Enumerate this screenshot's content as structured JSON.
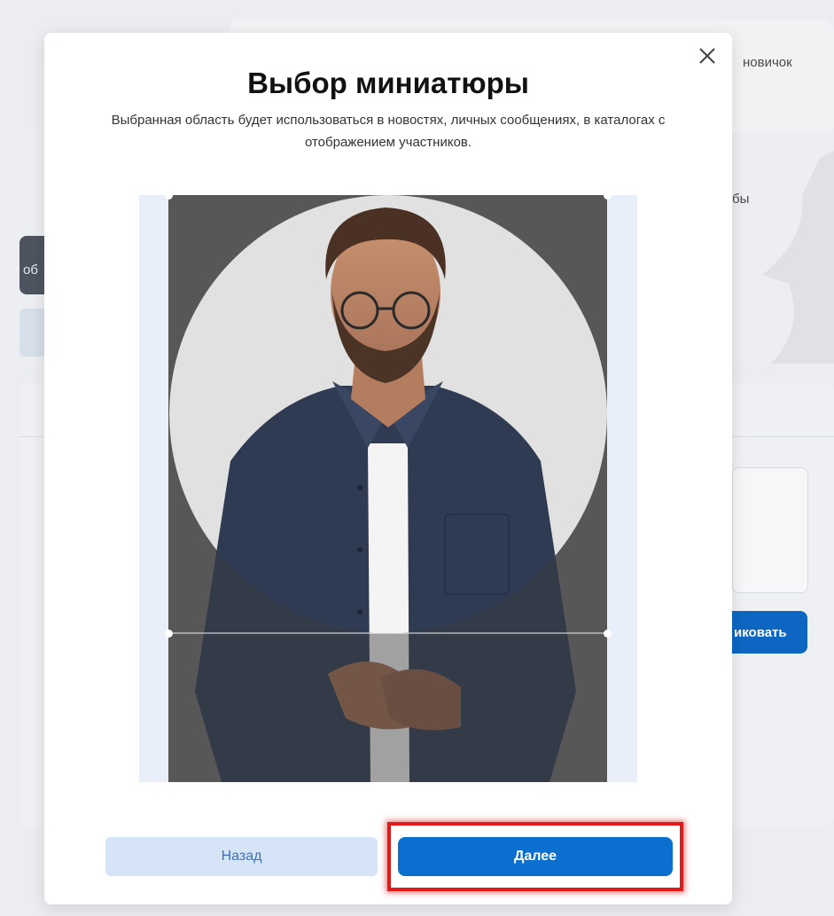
{
  "background": {
    "top_right_label": "новичок",
    "side_partial_text": "бы",
    "left_dark_button_fragment": "об",
    "publish_button_fragment": "иковать"
  },
  "modal": {
    "title": "Выбор миниатюры",
    "description": "Выбранная область будет использоваться в новостях, личных сообщениях, в каталогах с отображением участников.",
    "back_label": "Назад",
    "next_label": "Далее"
  },
  "colors": {
    "primary": "#0b6fd0",
    "secondary_bg": "#d6e4f7",
    "secondary_text": "#3a73b8",
    "highlight": "#e01a1a",
    "crop_bg": "#e9eefb"
  },
  "icons": {
    "close": "close-icon"
  }
}
